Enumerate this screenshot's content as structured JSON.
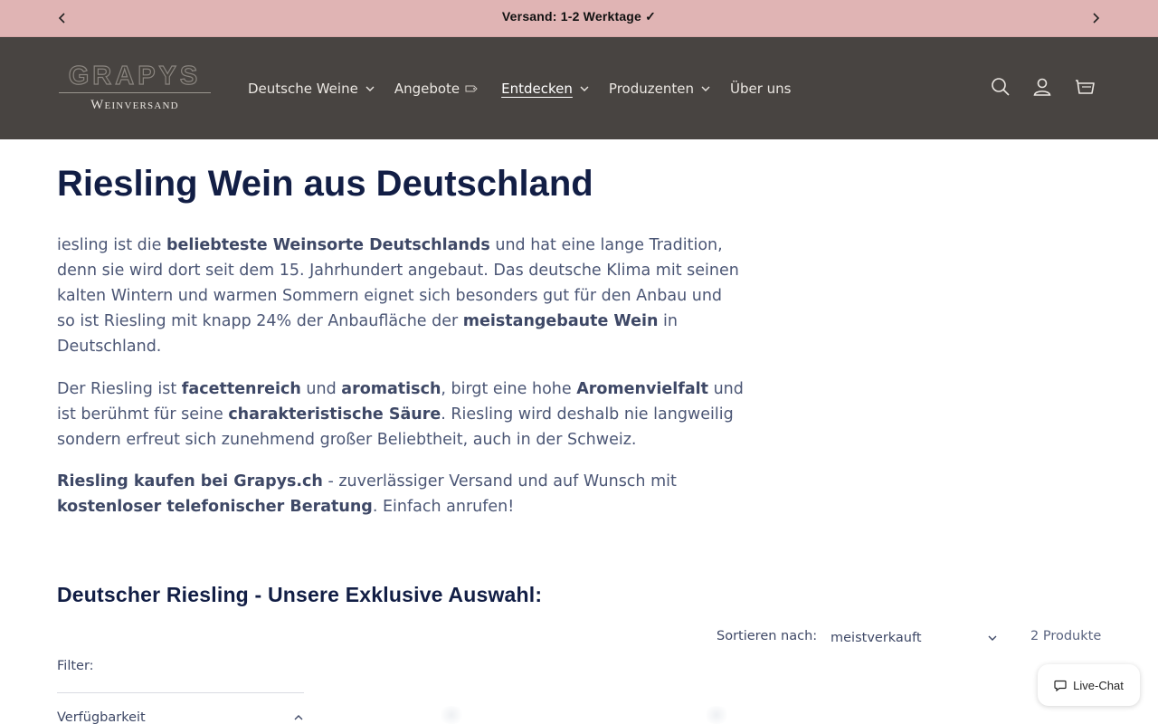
{
  "announcement": {
    "text": "Versand: 1-2 Werktage ✓",
    "prev_icon": "chevron-left-icon",
    "next_icon": "chevron-right-icon"
  },
  "header": {
    "logo_top": "GRAPYS",
    "logo_bottom": "Weinversand",
    "nav": [
      {
        "label": "Deutsche Weine",
        "dropdown": true
      },
      {
        "label": "Angebote",
        "icon": "price-tag-icon"
      },
      {
        "label": "Entdecken",
        "dropdown": true,
        "active": true
      },
      {
        "label": "Produzenten",
        "dropdown": true
      },
      {
        "label": "Über uns"
      }
    ],
    "icons": [
      "search-icon",
      "account-icon",
      "cart-icon"
    ]
  },
  "main": {
    "title": "Riesling Wein aus Deutschland",
    "p1": [
      {
        "t": "iesling ist die "
      },
      {
        "t": "beliebteste Weinsorte Deutschlands",
        "b": true
      },
      {
        "t": " und hat eine lange Tradition, denn sie wird dort seit dem 15. Jahrhundert angebaut. Das deutsche Klima mit seinen kalten Wintern und warmen Sommern eignet sich besonders gut für den Anbau und so ist Riesling mit knapp 24% der Anbaufläche der "
      },
      {
        "t": "meistangebaute Wein",
        "b": true
      },
      {
        "t": " in Deutschland."
      }
    ],
    "p2": [
      {
        "t": "Der Riesling ist "
      },
      {
        "t": "facettenreich",
        "b": true
      },
      {
        "t": " und "
      },
      {
        "t": "aromatisch",
        "b": true
      },
      {
        "t": ", birgt eine hohe "
      },
      {
        "t": "Aromenvielfalt",
        "b": true
      },
      {
        "t": " und ist berühmt für seine "
      },
      {
        "t": "charakteristische Säure",
        "b": true
      },
      {
        "t": ". Riesling wird deshalb nie langweilig sondern erfreut sich zunehmend großer Beliebtheit, auch in der Schweiz."
      }
    ],
    "p3": [
      {
        "t": "Riesling kaufen bei Grapys.ch",
        "b": true
      },
      {
        "t": " - zuverlässiger Versand und auf Wunsch mit "
      },
      {
        "t": "kostenloser telefonischer Beratung",
        "b": true
      },
      {
        "t": ". Einfach anrufen!"
      }
    ],
    "subtitle": "Deutscher Riesling - Unsere Exklusive Auswahl:"
  },
  "listing": {
    "sort_label": "Sortieren nach:",
    "sort_value": "meistverkauft",
    "count": "2 Produkte",
    "filter_label": "Filter:",
    "availability_label": "Verfügbarkeit"
  },
  "livechat": {
    "label": "Live-Chat",
    "icon": "chat-bubble-icon"
  },
  "colors": {
    "announcement_bg": "#e0b4b4",
    "header_bg": "#484441",
    "title": "#121e45",
    "body_text": "#4b5675"
  }
}
